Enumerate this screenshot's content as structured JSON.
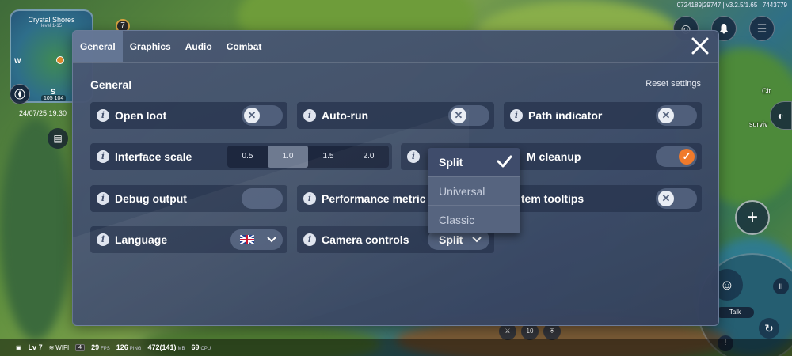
{
  "hud": {
    "minimap": {
      "title": "Crystal Shores",
      "subtitle": "level 1-15",
      "west": "W",
      "south": "S",
      "coords": "105  104"
    },
    "datetime": "24/07/25  19:30",
    "quest_count": "7",
    "build_info": "0724189|29747 | v3.2.5/1.65 | 7443779",
    "world_labels": [
      "Cit",
      "surviv"
    ],
    "talk_label": "Talk",
    "bottom_counter": "10"
  },
  "statusbar": {
    "level": "Lv 7",
    "network": "WIFI",
    "network_chip": "4",
    "fps_value": "29",
    "fps_unit": "FPS",
    "ping_value": "126",
    "ping_unit": "PING",
    "memory_value": "472(141)",
    "memory_unit": "MB",
    "cpu_value": "69",
    "cpu_unit": "CPU"
  },
  "settings": {
    "tabs": [
      "General",
      "Graphics",
      "Audio",
      "Combat"
    ],
    "active_tab": "General",
    "section_title": "General",
    "reset_label": "Reset settings",
    "rows": {
      "open_loot": {
        "label": "Open loot",
        "state": "off"
      },
      "auto_run": {
        "label": "Auto-run",
        "state": "off"
      },
      "path_indicator": {
        "label": "Path indicator",
        "state": "off"
      },
      "interface_scale": {
        "label": "Interface scale",
        "options": [
          "0.5",
          "1.0",
          "1.5",
          "2.0"
        ],
        "selected": "1.0"
      },
      "memory_cleanup": {
        "label_visible": "M cleanup",
        "state": "on"
      },
      "debug_output": {
        "label": "Debug output",
        "state": "unset"
      },
      "performance_metrics": {
        "label": "Performance metric"
      },
      "item_tooltips": {
        "label": "Item tooltips",
        "state": "off"
      },
      "language": {
        "label": "Language",
        "value": "English (UK)"
      },
      "camera_controls": {
        "label": "Camera controls",
        "value": "Split"
      }
    },
    "dropdown": {
      "options": [
        "Split",
        "Universal",
        "Classic"
      ],
      "selected": "Split"
    }
  },
  "colors": {
    "accent_on": "#f07a2b",
    "panel_bg": "#4a5874",
    "row_bg": "#28344e"
  }
}
